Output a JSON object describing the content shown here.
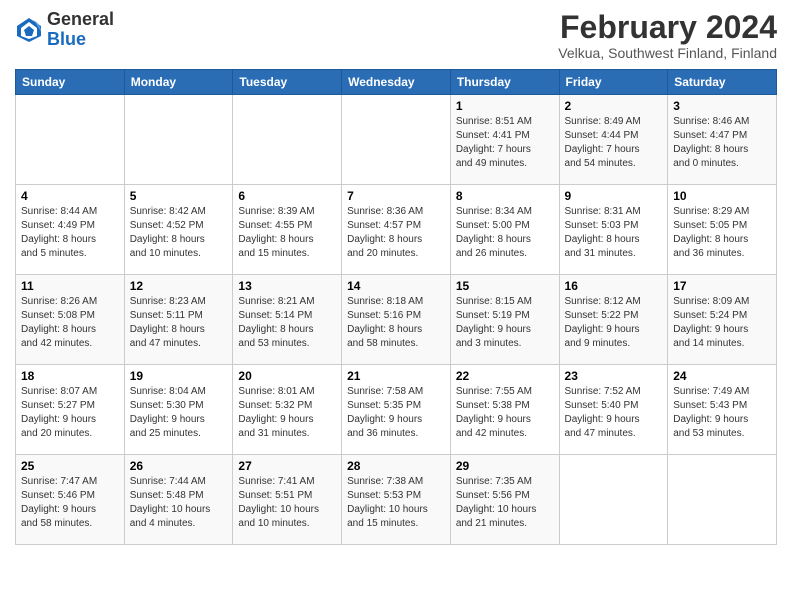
{
  "logo": {
    "general": "General",
    "blue": "Blue"
  },
  "header": {
    "month_year": "February 2024",
    "location": "Velkua, Southwest Finland, Finland"
  },
  "weekdays": [
    "Sunday",
    "Monday",
    "Tuesday",
    "Wednesday",
    "Thursday",
    "Friday",
    "Saturday"
  ],
  "weeks": [
    [
      {
        "day": "",
        "info": ""
      },
      {
        "day": "",
        "info": ""
      },
      {
        "day": "",
        "info": ""
      },
      {
        "day": "",
        "info": ""
      },
      {
        "day": "1",
        "info": "Sunrise: 8:51 AM\nSunset: 4:41 PM\nDaylight: 7 hours\nand 49 minutes."
      },
      {
        "day": "2",
        "info": "Sunrise: 8:49 AM\nSunset: 4:44 PM\nDaylight: 7 hours\nand 54 minutes."
      },
      {
        "day": "3",
        "info": "Sunrise: 8:46 AM\nSunset: 4:47 PM\nDaylight: 8 hours\nand 0 minutes."
      }
    ],
    [
      {
        "day": "4",
        "info": "Sunrise: 8:44 AM\nSunset: 4:49 PM\nDaylight: 8 hours\nand 5 minutes."
      },
      {
        "day": "5",
        "info": "Sunrise: 8:42 AM\nSunset: 4:52 PM\nDaylight: 8 hours\nand 10 minutes."
      },
      {
        "day": "6",
        "info": "Sunrise: 8:39 AM\nSunset: 4:55 PM\nDaylight: 8 hours\nand 15 minutes."
      },
      {
        "day": "7",
        "info": "Sunrise: 8:36 AM\nSunset: 4:57 PM\nDaylight: 8 hours\nand 20 minutes."
      },
      {
        "day": "8",
        "info": "Sunrise: 8:34 AM\nSunset: 5:00 PM\nDaylight: 8 hours\nand 26 minutes."
      },
      {
        "day": "9",
        "info": "Sunrise: 8:31 AM\nSunset: 5:03 PM\nDaylight: 8 hours\nand 31 minutes."
      },
      {
        "day": "10",
        "info": "Sunrise: 8:29 AM\nSunset: 5:05 PM\nDaylight: 8 hours\nand 36 minutes."
      }
    ],
    [
      {
        "day": "11",
        "info": "Sunrise: 8:26 AM\nSunset: 5:08 PM\nDaylight: 8 hours\nand 42 minutes."
      },
      {
        "day": "12",
        "info": "Sunrise: 8:23 AM\nSunset: 5:11 PM\nDaylight: 8 hours\nand 47 minutes."
      },
      {
        "day": "13",
        "info": "Sunrise: 8:21 AM\nSunset: 5:14 PM\nDaylight: 8 hours\nand 53 minutes."
      },
      {
        "day": "14",
        "info": "Sunrise: 8:18 AM\nSunset: 5:16 PM\nDaylight: 8 hours\nand 58 minutes."
      },
      {
        "day": "15",
        "info": "Sunrise: 8:15 AM\nSunset: 5:19 PM\nDaylight: 9 hours\nand 3 minutes."
      },
      {
        "day": "16",
        "info": "Sunrise: 8:12 AM\nSunset: 5:22 PM\nDaylight: 9 hours\nand 9 minutes."
      },
      {
        "day": "17",
        "info": "Sunrise: 8:09 AM\nSunset: 5:24 PM\nDaylight: 9 hours\nand 14 minutes."
      }
    ],
    [
      {
        "day": "18",
        "info": "Sunrise: 8:07 AM\nSunset: 5:27 PM\nDaylight: 9 hours\nand 20 minutes."
      },
      {
        "day": "19",
        "info": "Sunrise: 8:04 AM\nSunset: 5:30 PM\nDaylight: 9 hours\nand 25 minutes."
      },
      {
        "day": "20",
        "info": "Sunrise: 8:01 AM\nSunset: 5:32 PM\nDaylight: 9 hours\nand 31 minutes."
      },
      {
        "day": "21",
        "info": "Sunrise: 7:58 AM\nSunset: 5:35 PM\nDaylight: 9 hours\nand 36 minutes."
      },
      {
        "day": "22",
        "info": "Sunrise: 7:55 AM\nSunset: 5:38 PM\nDaylight: 9 hours\nand 42 minutes."
      },
      {
        "day": "23",
        "info": "Sunrise: 7:52 AM\nSunset: 5:40 PM\nDaylight: 9 hours\nand 47 minutes."
      },
      {
        "day": "24",
        "info": "Sunrise: 7:49 AM\nSunset: 5:43 PM\nDaylight: 9 hours\nand 53 minutes."
      }
    ],
    [
      {
        "day": "25",
        "info": "Sunrise: 7:47 AM\nSunset: 5:46 PM\nDaylight: 9 hours\nand 58 minutes."
      },
      {
        "day": "26",
        "info": "Sunrise: 7:44 AM\nSunset: 5:48 PM\nDaylight: 10 hours\nand 4 minutes."
      },
      {
        "day": "27",
        "info": "Sunrise: 7:41 AM\nSunset: 5:51 PM\nDaylight: 10 hours\nand 10 minutes."
      },
      {
        "day": "28",
        "info": "Sunrise: 7:38 AM\nSunset: 5:53 PM\nDaylight: 10 hours\nand 15 minutes."
      },
      {
        "day": "29",
        "info": "Sunrise: 7:35 AM\nSunset: 5:56 PM\nDaylight: 10 hours\nand 21 minutes."
      },
      {
        "day": "",
        "info": ""
      },
      {
        "day": "",
        "info": ""
      }
    ]
  ]
}
